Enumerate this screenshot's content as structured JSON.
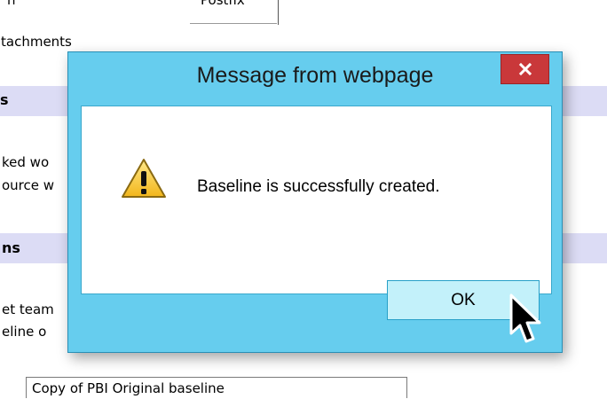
{
  "background": {
    "top_left_fragment": "n",
    "postfix_label": "Postfix",
    "attachments_fragment": "tachments",
    "section1_fragment": "s",
    "linked_fragment": "ked wo",
    "source_fragment": "ource w",
    "section2_fragment": "ns",
    "team_fragment": "et team",
    "baseline_fragment": "eline o",
    "baseline_name_value": "Copy of PBI Original baseline"
  },
  "dialog": {
    "title": "Message from webpage",
    "close_glyph": "x",
    "message": "Baseline is successfully created.",
    "ok_label": "OK"
  }
}
